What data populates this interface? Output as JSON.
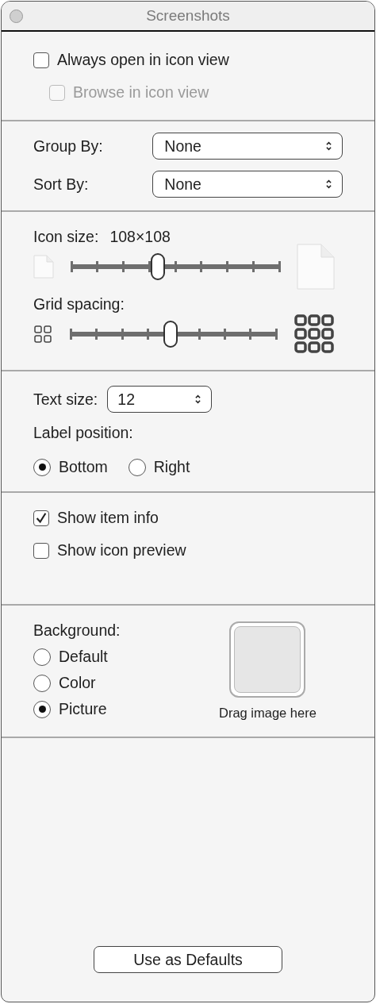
{
  "window": {
    "title": "Screenshots"
  },
  "view_options": [
    {
      "label": "Always open in icon view",
      "checked": false,
      "disabled": false,
      "children": [
        {
          "label": "Browse in icon view",
          "checked": false,
          "disabled": true
        }
      ]
    }
  ],
  "arrange": [
    {
      "label": "Group By:",
      "value": "None"
    },
    {
      "label": "Sort By:",
      "value": "None"
    }
  ],
  "icon_size": {
    "label": "Icon size:",
    "reading": "108×108",
    "level": 0.415
  },
  "grid_spacing": {
    "label": "Grid spacing:",
    "level": 0.485
  },
  "text_size": {
    "label": "Text size:",
    "value": "12"
  },
  "label_position": {
    "label": "Label position:",
    "options": [
      {
        "label": "Bottom",
        "selected": true
      },
      {
        "label": "Right",
        "selected": false
      }
    ]
  },
  "item_options": [
    {
      "label": "Show item info",
      "checked": true,
      "disabled": false
    },
    {
      "label": "Show icon preview",
      "checked": false,
      "disabled": false
    }
  ],
  "background": {
    "label": "Background:",
    "options": [
      {
        "label": "Default",
        "selected": false
      },
      {
        "label": "Color",
        "selected": false
      },
      {
        "label": "Picture",
        "selected": true
      }
    ],
    "drop_hint": "Drag image here"
  },
  "button": "Use as Defaults"
}
